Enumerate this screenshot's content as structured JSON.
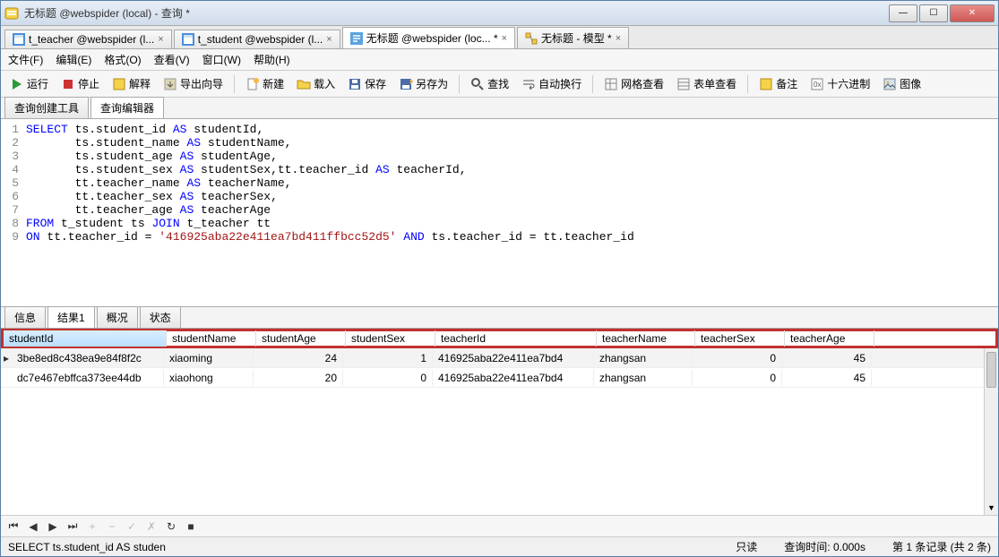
{
  "window": {
    "title": "无标题 @webspider (local) - 查询 *"
  },
  "doctabs": [
    {
      "label": "t_teacher @webspider (l...",
      "active": false
    },
    {
      "label": "t_student @webspider (l...",
      "active": false
    },
    {
      "label": "无标题 @webspider (loc... *",
      "active": true
    },
    {
      "label": "无标题 - 模型 *",
      "active": false
    }
  ],
  "menus": {
    "file": "文件(F)",
    "edit": "编辑(E)",
    "format": "格式(O)",
    "view": "查看(V)",
    "window": "窗口(W)",
    "help": "帮助(H)"
  },
  "toolbar": {
    "run": "运行",
    "stop": "停止",
    "explain": "解释",
    "export": "导出向导",
    "new": "新建",
    "load": "载入",
    "save": "保存",
    "saveas": "另存为",
    "find": "查找",
    "wrap": "自动换行",
    "gridview": "网格查看",
    "formview": "表单查看",
    "notes": "备注",
    "hex": "十六进制",
    "image": "图像"
  },
  "subtabs": {
    "builder": "查询创建工具",
    "editor": "查询编辑器"
  },
  "sql": {
    "lines": [
      "SELECT ts.student_id AS studentId,",
      "       ts.student_name AS studentName,",
      "       ts.student_age AS studentAge,",
      "       ts.student_sex AS studentSex,tt.teacher_id AS teacherId,",
      "       tt.teacher_name AS teacherName,",
      "       tt.teacher_sex AS teacherSex,",
      "       tt.teacher_age AS teacherAge",
      "FROM t_student ts JOIN t_teacher tt",
      "ON tt.teacher_id = '416925aba22e411ea7bd411ffbcc52d5' AND ts.teacher_id = tt.teacher_id"
    ]
  },
  "restabs": {
    "info": "信息",
    "result1": "结果1",
    "profile": "概况",
    "status": "状态"
  },
  "columns": [
    "studentId",
    "studentName",
    "studentAge",
    "studentSex",
    "teacherId",
    "teacherName",
    "teacherSex",
    "teacherAge"
  ],
  "rows": [
    {
      "studentId": "3be8ed8c438ea9e84f8f2c",
      "studentName": "xiaoming",
      "studentAge": "24",
      "studentSex": "1",
      "teacherId": "416925aba22e411ea7bd4",
      "teacherName": "zhangsan",
      "teacherSex": "0",
      "teacherAge": "45"
    },
    {
      "studentId": "dc7e467ebffca373ee44db",
      "studentName": "xiaohong",
      "studentAge": "20",
      "studentSex": "0",
      "teacherId": "416925aba22e411ea7bd4",
      "teacherName": "zhangsan",
      "teacherSex": "0",
      "teacherAge": "45"
    }
  ],
  "status": {
    "left": "SELECT ts.student_id AS studen",
    "readonly": "只读",
    "time": "查询时间: 0.000s",
    "records": "第 1 条记录 (共 2 条)"
  }
}
